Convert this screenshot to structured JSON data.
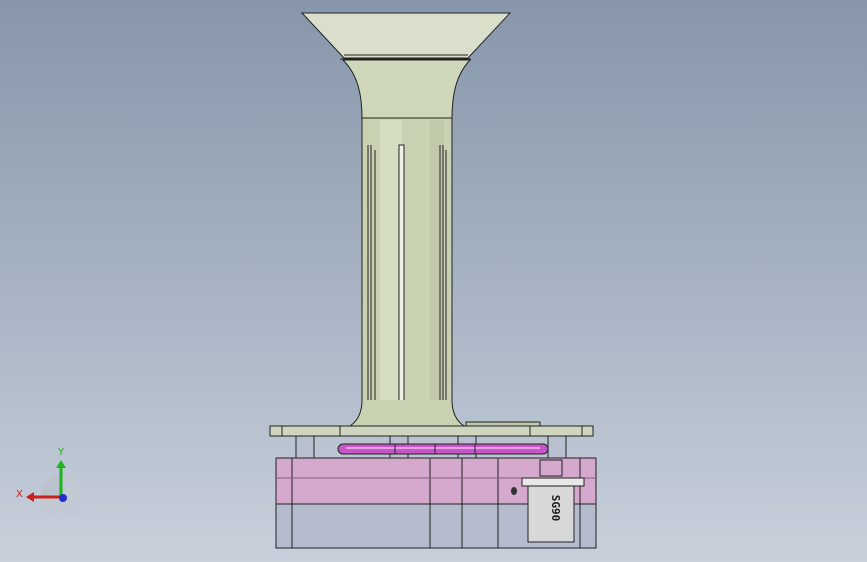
{
  "viewport": {
    "background_top": "#8796aa",
    "background_bottom": "#c8d0db"
  },
  "model": {
    "funnel_color": "#d6dcc6",
    "tube_color": "#c9d2b4",
    "plate_color": "#cfd6c0",
    "ring_color": "#c855c8",
    "base_color": "#d4a8cc",
    "base_lower_color": "#b5bccc",
    "edge_color": "#222222",
    "servo_label": "SG90"
  },
  "triad": {
    "x_label": "X",
    "y_label": "Y",
    "x_color": "#cc1f1f",
    "y_color": "#1fb41f",
    "z_color": "#1f2fcc"
  }
}
